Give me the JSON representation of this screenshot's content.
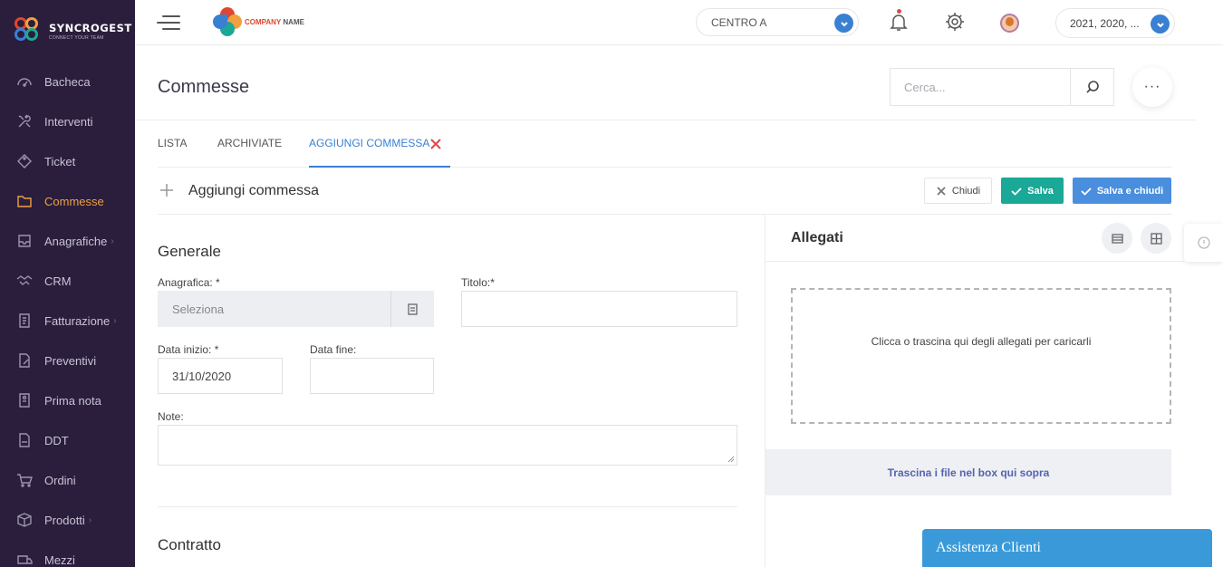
{
  "app": {
    "brand_name": "SYNCROGEST",
    "brand_tagline": "CONNECT YOUR TEAM",
    "company_logo_text_1": "COMPANY",
    "company_logo_text_2": "NAME"
  },
  "sidebar": {
    "items": [
      {
        "label": "Bacheca",
        "icon": "dashboard-icon",
        "active": false,
        "has_submenu": false
      },
      {
        "label": "Interventi",
        "icon": "tools-icon",
        "active": false,
        "has_submenu": false
      },
      {
        "label": "Ticket",
        "icon": "ticket-icon",
        "active": false,
        "has_submenu": false
      },
      {
        "label": "Commesse",
        "icon": "folder-icon",
        "active": true,
        "has_submenu": false
      },
      {
        "label": "Anagrafiche",
        "icon": "inbox-icon",
        "active": false,
        "has_submenu": true
      },
      {
        "label": "CRM",
        "icon": "handshake-icon",
        "active": false,
        "has_submenu": false
      },
      {
        "label": "Fatturazione",
        "icon": "invoice-icon",
        "active": false,
        "has_submenu": true
      },
      {
        "label": "Preventivi",
        "icon": "file-edit-icon",
        "active": false,
        "has_submenu": false
      },
      {
        "label": "Prima nota",
        "icon": "note-icon",
        "active": false,
        "has_submenu": false
      },
      {
        "label": "DDT",
        "icon": "document-icon",
        "active": false,
        "has_submenu": false
      },
      {
        "label": "Ordini",
        "icon": "cart-icon",
        "active": false,
        "has_submenu": false
      },
      {
        "label": "Prodotti",
        "icon": "box-icon",
        "active": false,
        "has_submenu": true
      },
      {
        "label": "Mezzi",
        "icon": "vehicle-icon",
        "active": false,
        "has_submenu": false
      }
    ]
  },
  "topbar": {
    "center_select": "CENTRO A",
    "years_select": "2021, 2020, ..."
  },
  "page": {
    "title": "Commesse",
    "search_placeholder": "Cerca...",
    "more_label": "···"
  },
  "tabs": [
    {
      "label": "LISTA",
      "active": false
    },
    {
      "label": "ARCHIVIATE",
      "active": false
    },
    {
      "label": "AGGIUNGI COMMESSA",
      "active": true
    }
  ],
  "form": {
    "title": "Aggiungi commessa",
    "buttons": {
      "close": "Chiudi",
      "save": "Salva",
      "save_close": "Salva e chiudi"
    },
    "section_general": "Generale",
    "anagrafica_label": "Anagrafica: *",
    "anagrafica_value": "Seleziona",
    "titolo_label": "Titolo:*",
    "titolo_value": "",
    "data_inizio_label": "Data inizio: *",
    "data_inizio_value": "31/10/2020",
    "data_fine_label": "Data fine:",
    "data_fine_value": "",
    "note_label": "Note:",
    "note_value": "",
    "section_contract": "Contratto"
  },
  "attachments": {
    "title": "Allegati",
    "dropzone_text": "Clicca o trascina qui degli allegati per caricarli",
    "drop_hint": "Trascina i file nel box qui sopra"
  },
  "support": {
    "label": "Assistenza Clienti"
  },
  "colors": {
    "sidebar_bg": "#2a1e3c",
    "active_nav": "#f0a040",
    "primary_blue": "#3a80d2",
    "save_green": "#1aa897",
    "save_close_blue": "#4a8ede",
    "close_red": "#e04848",
    "support_blue": "#3a9ad9"
  }
}
